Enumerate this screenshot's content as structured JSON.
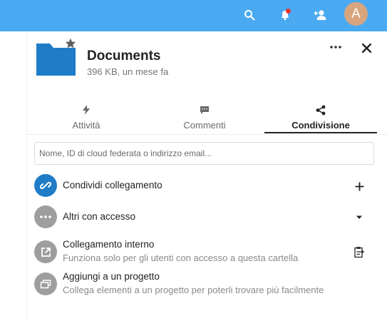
{
  "header": {
    "avatar_letter": "A",
    "icons": [
      "search-icon",
      "notifications-icon",
      "contacts-icon"
    ],
    "accent_color": "#4aaaf1"
  },
  "details": {
    "title": "Documents",
    "subtitle": "396 KB, un mese fa",
    "folder_color": "#1f7cc7"
  },
  "tabs": [
    {
      "label": "Attività",
      "icon": "activity-icon",
      "active": false
    },
    {
      "label": "Commenti",
      "icon": "comment-icon",
      "active": false
    },
    {
      "label": "Condivisione",
      "icon": "share-icon",
      "active": true
    }
  ],
  "share": {
    "placeholder": "Nome, ID di cloud federata o indirizzo email..."
  },
  "entries": [
    {
      "title": "Condividi collegamento",
      "icon": "link-icon",
      "action_icon": "plus-icon"
    },
    {
      "title": "Altri con accesso",
      "icon": "ellipsis-icon",
      "action_icon": "caret-down-icon"
    },
    {
      "title": "Collegamento interno",
      "subtitle": "Funziona solo per gli utenti con accesso a questa cartella",
      "icon": "external-link-icon",
      "action_icon": "clipboard-icon"
    },
    {
      "title": "Aggiungi a un progetto",
      "subtitle": "Collega elementi a un progetto per poterli trovare più facilmente",
      "icon": "projects-icon"
    }
  ]
}
